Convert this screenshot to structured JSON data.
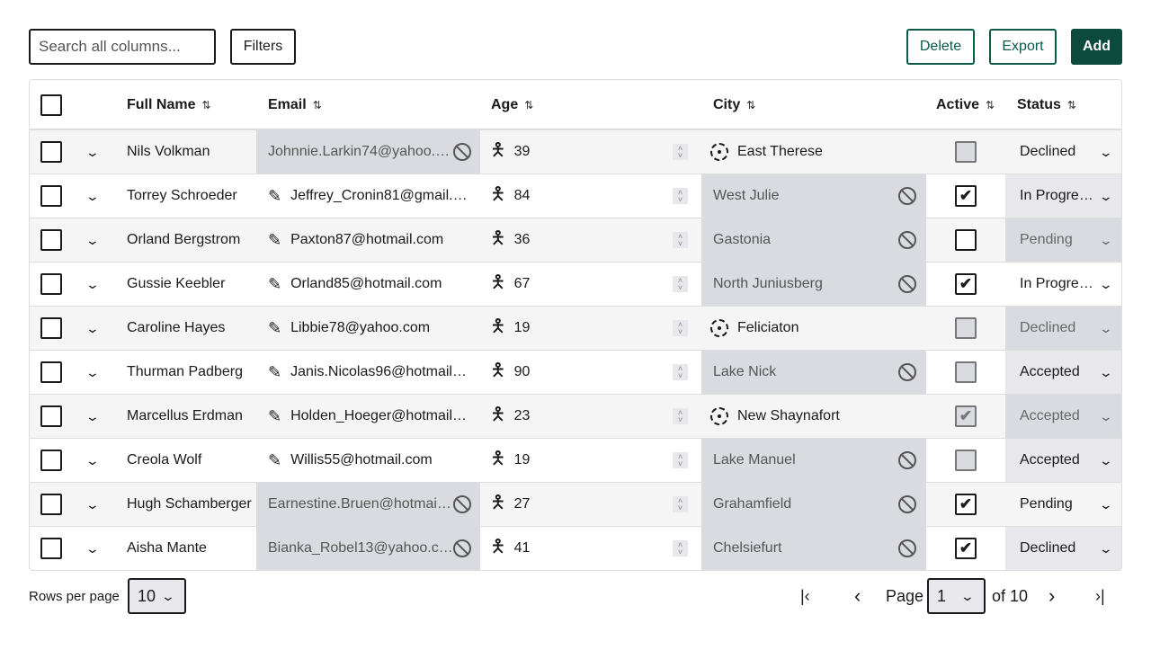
{
  "toolbar": {
    "search_placeholder": "Search all columns...",
    "filters": "Filters",
    "delete": "Delete",
    "export": "Export",
    "add": "Add"
  },
  "columns": {
    "full_name": "Full Name",
    "email": "Email",
    "age": "Age",
    "city": "City",
    "active": "Active",
    "status": "Status"
  },
  "rows": [
    {
      "name": "Nils Volkman",
      "email": "Johnnie.Larkin74@yahoo.c …",
      "email_disabled": true,
      "age": "39",
      "city": "East Therese",
      "city_disabled": false,
      "active": false,
      "active_disabled": true,
      "status": "Declined",
      "status_state": "normal"
    },
    {
      "name": "Torrey Schroeder",
      "email": "Jeffrey_Cronin81@gmail. …",
      "email_disabled": false,
      "age": "84",
      "city": "West Julie",
      "city_disabled": true,
      "active": true,
      "active_disabled": false,
      "status": "In Progre…",
      "status_state": "shaded"
    },
    {
      "name": "Orland Bergstrom",
      "email": "Paxton87@hotmail.com",
      "email_disabled": false,
      "age": "36",
      "city": "Gastonia",
      "city_disabled": true,
      "active": false,
      "active_disabled": false,
      "status": "Pending",
      "status_state": "disabled"
    },
    {
      "name": "Gussie Keebler",
      "email": "Orland85@hotmail.com",
      "email_disabled": false,
      "age": "67",
      "city": "North Juniusberg",
      "city_disabled": true,
      "active": true,
      "active_disabled": false,
      "status": "In Progre…",
      "status_state": "normal"
    },
    {
      "name": "Caroline Hayes",
      "email": "Libbie78@yahoo.com",
      "email_disabled": false,
      "age": "19",
      "city": "Feliciaton",
      "city_disabled": false,
      "active": false,
      "active_disabled": true,
      "status": "Declined",
      "status_state": "disabled"
    },
    {
      "name": "Thurman Padberg",
      "email": "Janis.Nicolas96@hotmail. …",
      "email_disabled": false,
      "age": "90",
      "city": "Lake Nick",
      "city_disabled": true,
      "active": false,
      "active_disabled": true,
      "status": "Accepted",
      "status_state": "shaded"
    },
    {
      "name": "Marcellus Erdman",
      "email": "Holden_Hoeger@hotmail. …",
      "email_disabled": false,
      "age": "23",
      "city": "New Shaynafort",
      "city_disabled": false,
      "active": true,
      "active_disabled": true,
      "status": "Accepted",
      "status_state": "disabled"
    },
    {
      "name": "Creola Wolf",
      "email": "Willis55@hotmail.com",
      "email_disabled": false,
      "age": "19",
      "city": "Lake Manuel",
      "city_disabled": true,
      "active": false,
      "active_disabled": true,
      "status": "Accepted",
      "status_state": "shaded"
    },
    {
      "name": "Hugh Schamberger",
      "email": "Earnestine.Bruen@hotmail.…",
      "email_disabled": true,
      "age": "27",
      "city": "Grahamfield",
      "city_disabled": true,
      "active": true,
      "active_disabled": false,
      "status": "Pending",
      "status_state": "normal"
    },
    {
      "name": "Aisha Mante",
      "email": "Bianka_Robel13@yahoo.com",
      "email_disabled": true,
      "age": "41",
      "city": "Chelsiefurt",
      "city_disabled": true,
      "active": true,
      "active_disabled": false,
      "status": "Declined",
      "status_state": "shaded"
    }
  ],
  "footer": {
    "rows_per_page_label": "Rows per page",
    "rows_per_page": "10",
    "page_label": "Page",
    "page": "1",
    "of_label": "of 10"
  }
}
